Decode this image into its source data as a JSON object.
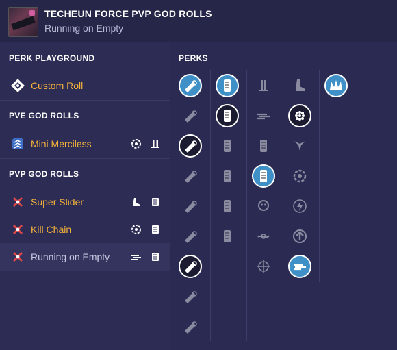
{
  "header": {
    "title": "TECHEUN FORCE PVP GOD ROLLS",
    "subtitle": "Running on Empty"
  },
  "sidebar": {
    "sections": [
      {
        "heading": "PERK PLAYGROUND",
        "rows": [
          {
            "label": "Custom Roll",
            "icon": "diamond-target-icon",
            "perks": []
          }
        ]
      },
      {
        "heading": "PVE GOD ROLLS",
        "rows": [
          {
            "label": "Mini Merciless",
            "icon": "chevrons-icon",
            "perks": [
              "cog-perk-icon",
              "bolts-perk-icon"
            ]
          }
        ]
      },
      {
        "heading": "PVP GOD ROLLS",
        "rows": [
          {
            "label": "Super Slider",
            "icon": "crossed-x-icon",
            "perks": [
              "boot-perk-icon",
              "mag-perk-icon"
            ]
          },
          {
            "label": "Kill Chain",
            "icon": "crossed-x-icon",
            "perks": [
              "cog-perk-icon",
              "mag-perk-icon"
            ]
          },
          {
            "label": "Running on Empty",
            "icon": "crossed-x-icon",
            "perks": [
              "dash-perk-icon",
              "mag-perk-icon"
            ],
            "selected": true
          }
        ]
      }
    ]
  },
  "perks": {
    "heading": "PERKS",
    "columns": [
      [
        {
          "icon": "barrel-perk-icon",
          "state": "selected"
        },
        {
          "icon": "barrel-perk-icon",
          "state": "dim"
        },
        {
          "icon": "barrel-perk-icon",
          "state": "highlighted"
        },
        {
          "icon": "barrel-perk-icon",
          "state": "dim"
        },
        {
          "icon": "barrel-perk-icon",
          "state": "dim"
        },
        {
          "icon": "barrel-perk-icon",
          "state": "dim"
        },
        {
          "icon": "barrel-perk-icon",
          "state": "highlighted"
        },
        {
          "icon": "barrel-perk-icon",
          "state": "dim"
        },
        {
          "icon": "barrel-perk-icon",
          "state": "dim"
        }
      ],
      [
        {
          "icon": "mag-perk-icon",
          "state": "selected"
        },
        {
          "icon": "mag-perk-icon",
          "state": "highlighted"
        },
        {
          "icon": "mag-perk-icon",
          "state": "dim"
        },
        {
          "icon": "mag-perk-icon",
          "state": "dim"
        },
        {
          "icon": "mag-perk-icon",
          "state": "dim"
        },
        {
          "icon": "mag-perk-icon",
          "state": "dim"
        }
      ],
      [
        {
          "icon": "bolts-perk-icon",
          "state": "dim"
        },
        {
          "icon": "dash-perk-icon",
          "state": "dim"
        },
        {
          "icon": "mag-perk-icon",
          "state": "dim"
        },
        {
          "icon": "mag-perk-icon",
          "state": "selected"
        },
        {
          "icon": "skull-perk-icon",
          "state": "dim"
        },
        {
          "icon": "link-perk-icon",
          "state": "dim"
        },
        {
          "icon": "target-perk-icon",
          "state": "dim"
        }
      ],
      [
        {
          "icon": "boot-perk-icon",
          "state": "dim"
        },
        {
          "icon": "dots-perk-icon",
          "state": "highlighted"
        },
        {
          "icon": "horns-perk-icon",
          "state": "dim"
        },
        {
          "icon": "cog-perk-icon",
          "state": "dim"
        },
        {
          "icon": "bolt-perk-icon",
          "state": "dim"
        },
        {
          "icon": "arrow-up-perk-icon",
          "state": "dim"
        },
        {
          "icon": "dash-perk-icon",
          "state": "selected"
        }
      ],
      [
        {
          "icon": "crown-perk-icon",
          "state": "selected"
        }
      ]
    ]
  },
  "colors": {
    "accent_orange": "#f5b23a",
    "perk_blue": "#3f90c7",
    "background": "#2a2a52"
  }
}
